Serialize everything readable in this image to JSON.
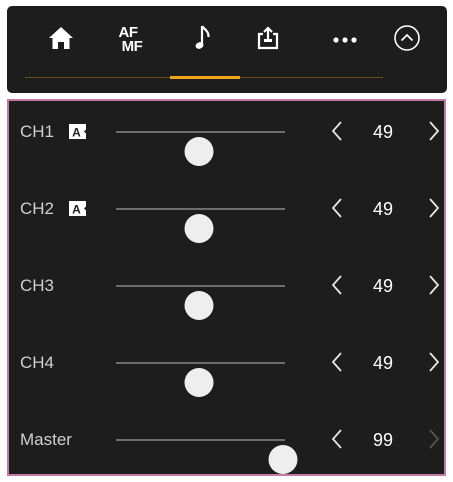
{
  "tabs": [
    {
      "icon": "home-icon",
      "label": ""
    },
    {
      "icon": "af-mf-icon",
      "label_top": "AF",
      "label_bottom": "MF"
    },
    {
      "icon": "music-note-icon",
      "label": "",
      "active": true
    },
    {
      "icon": "share-icon",
      "label": ""
    },
    {
      "icon": "more-icon",
      "label": ""
    },
    {
      "icon": "chevron-up-circle-icon",
      "label": ""
    }
  ],
  "accent_color": "#f0a419",
  "panel_border_color": "#c47aa4",
  "channels": [
    {
      "label": "CH1",
      "auto": true,
      "auto_badge": "A",
      "level": 49,
      "level_fraction": 0.49,
      "decrease_label": "‹",
      "increase_label": "›"
    },
    {
      "label": "CH2",
      "auto": true,
      "auto_badge": "A",
      "level": 49,
      "level_fraction": 0.49,
      "decrease_label": "‹",
      "increase_label": "›"
    },
    {
      "label": "CH3",
      "auto": false,
      "level": 49,
      "level_fraction": 0.49,
      "decrease_label": "‹",
      "increase_label": "›"
    },
    {
      "label": "CH4",
      "auto": false,
      "level": 49,
      "level_fraction": 0.49,
      "decrease_label": "‹",
      "increase_label": "›"
    },
    {
      "label": "Master",
      "auto": false,
      "level": 99,
      "level_fraction": 0.99,
      "decrease_label": "‹",
      "increase_label": "›",
      "increase_disabled": true
    }
  ]
}
